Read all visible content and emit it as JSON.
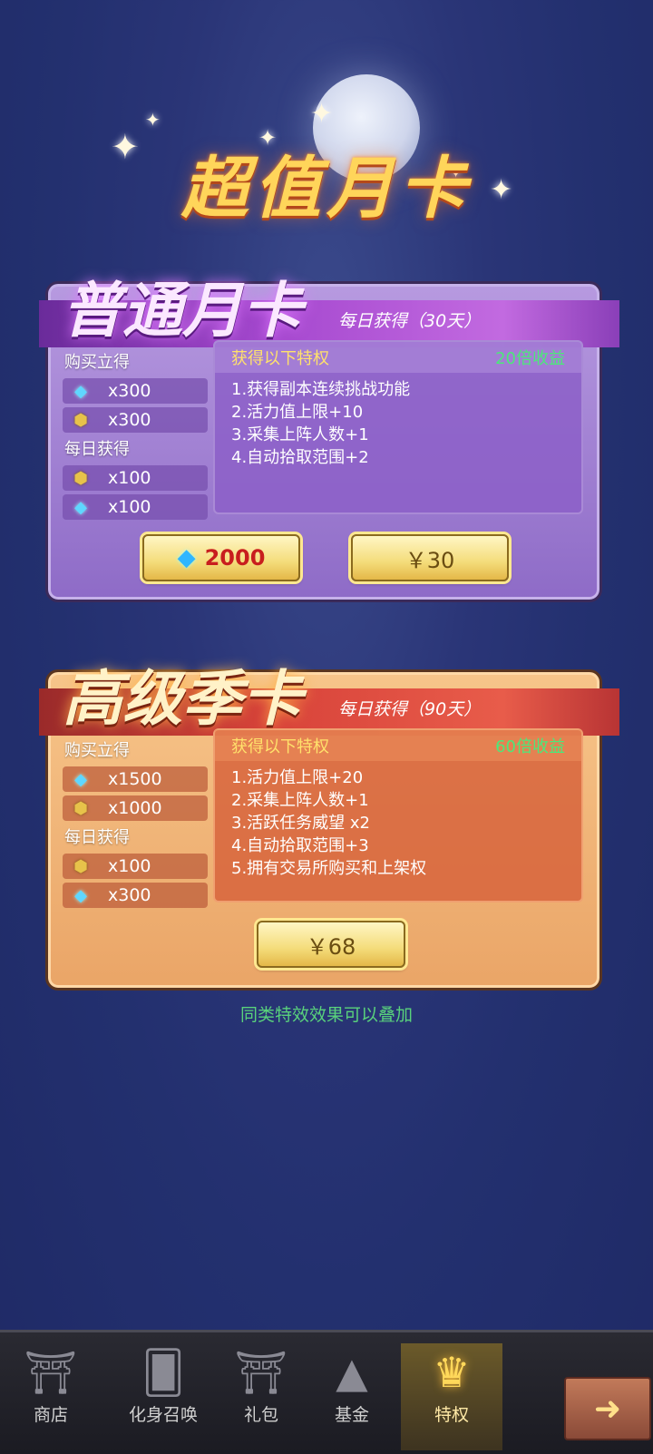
{
  "header": {
    "title": "超值月卡"
  },
  "cards": [
    {
      "title": "普通月卡",
      "daily_note": "每日获得（30天）",
      "buy_label": "购买立得",
      "buy_rewards": [
        {
          "icon": "gem-icon",
          "value": "x300"
        },
        {
          "icon": "coin-icon",
          "value": "x300"
        }
      ],
      "daily_label": "每日获得",
      "daily_rewards": [
        {
          "icon": "coin-icon",
          "value": "x100"
        },
        {
          "icon": "gem-icon",
          "value": "x100"
        }
      ],
      "perks_title": "获得以下特权",
      "multiplier": "20倍收益",
      "perks": [
        "1.获得副本连续挑战功能",
        "2.活力值上限+10",
        "3.采集上阵人数+1",
        "4.自动拾取范围+2"
      ],
      "gem_price": "2000",
      "cash_price": "￥30"
    },
    {
      "title": "高级季卡",
      "daily_note": "每日获得（90天）",
      "buy_label": "购买立得",
      "buy_rewards": [
        {
          "icon": "gem-icon",
          "value": "x1500"
        },
        {
          "icon": "coin-icon",
          "value": "x1000"
        }
      ],
      "daily_label": "每日获得",
      "daily_rewards": [
        {
          "icon": "coin-icon",
          "value": "x100"
        },
        {
          "icon": "gem-icon",
          "value": "x300"
        }
      ],
      "perks_title": "获得以下特权",
      "multiplier": "60倍收益",
      "perks": [
        "1.活力值上限+20",
        "2.采集上阵人数+1",
        "3.活跃任务威望 x2",
        "4.自动拾取范围+3",
        "5.拥有交易所购买和上架权"
      ],
      "cash_price": "￥68"
    }
  ],
  "footnote": "同类特效效果可以叠加",
  "nav": {
    "items": [
      {
        "label": "商店",
        "icon": "shop-gate-icon"
      },
      {
        "label": "化身召唤",
        "icon": "summon-cards-icon"
      },
      {
        "label": "礼包",
        "icon": "gift-gate-icon"
      },
      {
        "label": "基金",
        "icon": "fund-icon"
      },
      {
        "label": "特权",
        "icon": "crown-icon",
        "active": true
      }
    ]
  },
  "colors": {
    "purple_card": "#9a7ad0",
    "orange_card": "#efb171",
    "title_gold": "#ffd55a",
    "multiplier_green": "#4ce87a",
    "perk_header_yellow": "#ffe16b",
    "footnote_green": "#59d27c"
  }
}
